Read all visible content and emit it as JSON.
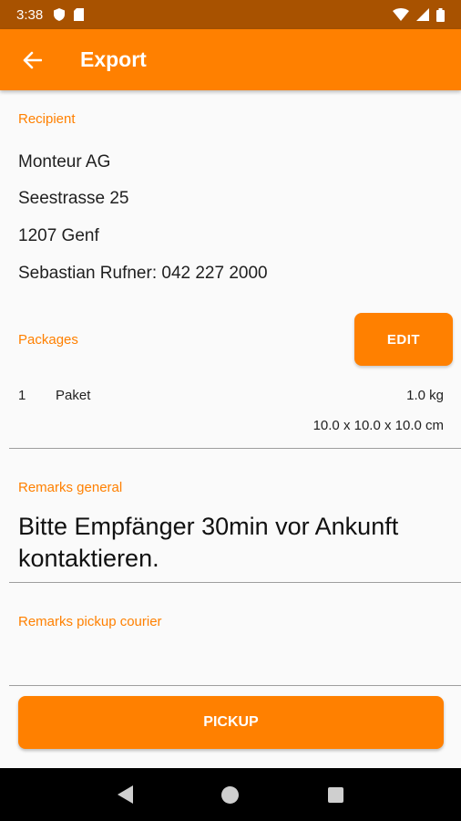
{
  "status_bar": {
    "time": "3:38"
  },
  "header": {
    "title": "Export",
    "back_icon": "arrow-left-icon"
  },
  "recipient": {
    "label": "Recipient",
    "lines": [
      "Monteur AG",
      "Seestrasse 25",
      "1207  Genf",
      "Sebastian Rufner: 042 227 2000"
    ]
  },
  "packages": {
    "label": "Packages",
    "edit_label": "EDIT",
    "items": [
      {
        "count": "1",
        "name": "Paket",
        "weight": "1.0 kg",
        "dimensions": "10.0 x 10.0 x 10.0 cm"
      }
    ]
  },
  "remarks_general": {
    "label": "Remarks general",
    "text": "Bitte Empfänger 30min vor Ankunft kontaktieren."
  },
  "remarks_pickup": {
    "label": "Remarks pickup courier",
    "text": ""
  },
  "pickup_button": {
    "label": "PICKUP"
  },
  "colors": {
    "accent": "#ff8000",
    "status_bar": "#a85200"
  }
}
